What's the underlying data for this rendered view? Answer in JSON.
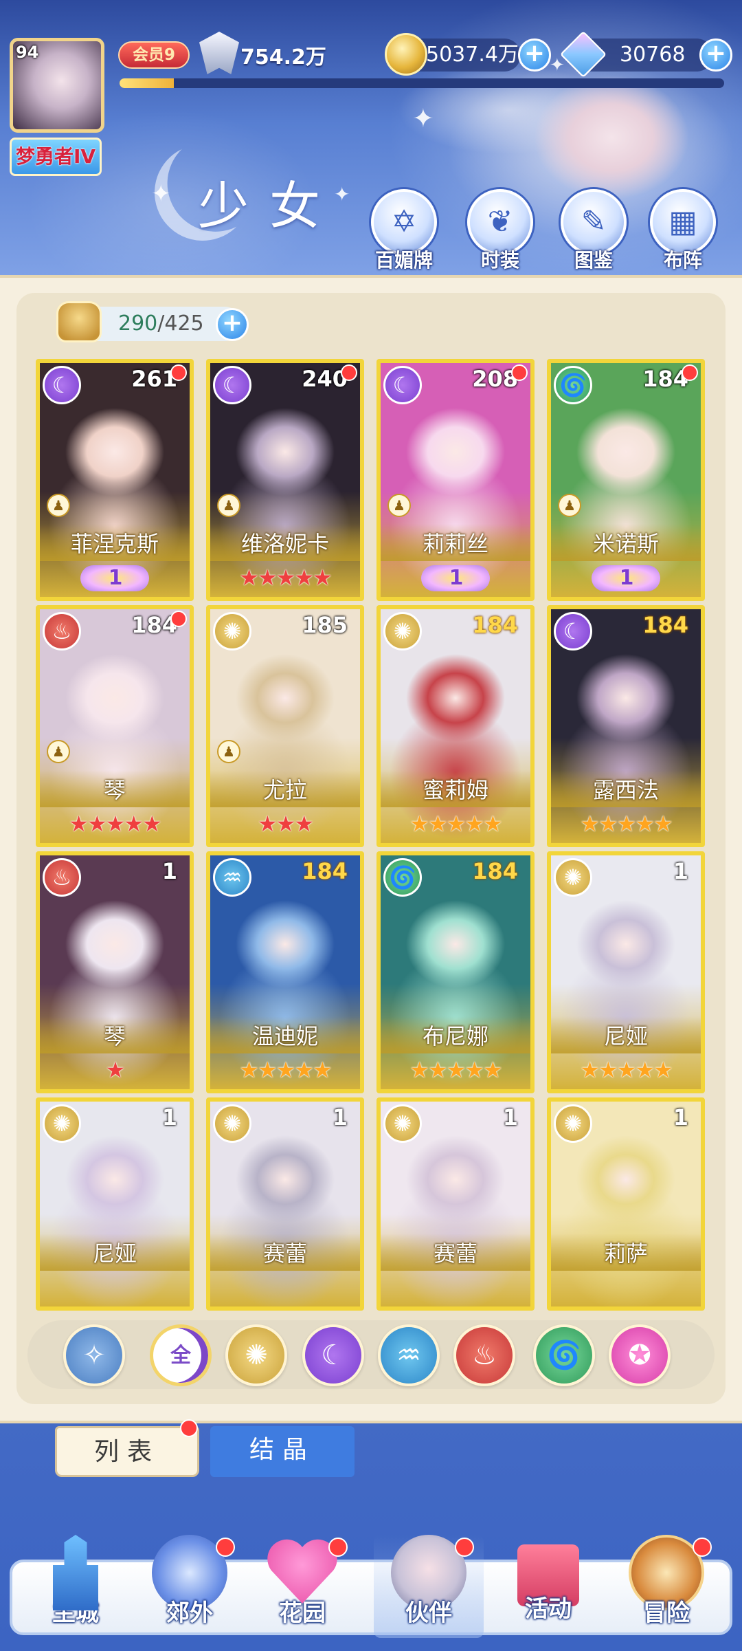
{
  "header": {
    "player_level": "94",
    "player_title": "梦勇者IV",
    "vip_label": "会员9",
    "power": "754.2万",
    "exp_progress": 0.09,
    "gold": "5037.4万",
    "gems": "30768",
    "page_title": "少女",
    "nav": [
      {
        "label": "百媚牌",
        "icon": "card-icon"
      },
      {
        "label": "时装",
        "icon": "outfit-icon"
      },
      {
        "label": "图鉴",
        "icon": "book-icon"
      },
      {
        "label": "布阵",
        "icon": "formation-icon"
      }
    ]
  },
  "collection": {
    "current": "290",
    "total": "425"
  },
  "cards": [
    {
      "name": "菲涅克斯",
      "level": "261",
      "element": "moon",
      "stars": "",
      "star_color": "",
      "wing": "1",
      "dot": true,
      "pawn": true,
      "level_gold": false
    },
    {
      "name": "维洛妮卡",
      "level": "240",
      "element": "moon",
      "stars": "★★★★★",
      "star_color": "red",
      "wing": "",
      "dot": true,
      "pawn": true,
      "level_gold": false
    },
    {
      "name": "莉莉丝",
      "level": "208",
      "element": "moon",
      "stars": "",
      "star_color": "",
      "wing": "1",
      "dot": true,
      "pawn": true,
      "level_gold": false
    },
    {
      "name": "米诺斯",
      "level": "184",
      "element": "wind",
      "stars": "",
      "star_color": "",
      "wing": "1",
      "dot": true,
      "pawn": true,
      "level_gold": false
    },
    {
      "name": "琴",
      "level": "184",
      "element": "fire",
      "stars": "★★★★★",
      "star_color": "red",
      "wing": "",
      "dot": true,
      "pawn": true,
      "level_gold": false
    },
    {
      "name": "尤拉",
      "level": "185",
      "element": "sun",
      "stars": "★★★",
      "star_color": "red",
      "wing": "",
      "dot": false,
      "pawn": true,
      "level_gold": false
    },
    {
      "name": "蜜莉姆",
      "level": "184",
      "element": "sun",
      "stars": "★★★★★",
      "star_color": "gold",
      "wing": "",
      "dot": false,
      "pawn": false,
      "level_gold": true
    },
    {
      "name": "露西法",
      "level": "184",
      "element": "moon",
      "stars": "★★★★★",
      "star_color": "gold",
      "wing": "",
      "dot": false,
      "pawn": false,
      "level_gold": true
    },
    {
      "name": "琴",
      "level": "1",
      "element": "fire",
      "stars": "★",
      "star_color": "red",
      "wing": "",
      "dot": false,
      "pawn": false,
      "level_gold": false
    },
    {
      "name": "温迪妮",
      "level": "184",
      "element": "water",
      "stars": "★★★★★",
      "star_color": "gold",
      "wing": "",
      "dot": false,
      "pawn": false,
      "level_gold": true
    },
    {
      "name": "布尼娜",
      "level": "184",
      "element": "wind",
      "stars": "★★★★★",
      "star_color": "gold",
      "wing": "",
      "dot": false,
      "pawn": false,
      "level_gold": true
    },
    {
      "name": "尼娅",
      "level": "1",
      "element": "sun",
      "stars": "★★★★★",
      "star_color": "gold",
      "wing": "",
      "dot": false,
      "pawn": false,
      "level_gold": false
    },
    {
      "name": "尼娅",
      "level": "1",
      "element": "sun",
      "stars": "",
      "star_color": "",
      "wing": "",
      "dot": false,
      "pawn": false,
      "level_gold": false
    },
    {
      "name": "赛蕾",
      "level": "1",
      "element": "sun",
      "stars": "",
      "star_color": "",
      "wing": "",
      "dot": false,
      "pawn": false,
      "level_gold": false
    },
    {
      "name": "赛蕾",
      "level": "1",
      "element": "sun",
      "stars": "",
      "star_color": "",
      "wing": "",
      "dot": false,
      "pawn": false,
      "level_gold": false
    },
    {
      "name": "莉萨",
      "level": "1",
      "element": "sun",
      "stars": "",
      "star_color": "",
      "wing": "",
      "dot": false,
      "pawn": false,
      "level_gold": false
    }
  ],
  "filters": [
    {
      "label": "",
      "icon": "rank-icon",
      "kind": "rank"
    },
    {
      "label": "全",
      "icon": "all-icon",
      "kind": "all"
    },
    {
      "label": "",
      "icon": "sun-icon",
      "kind": "sun"
    },
    {
      "label": "",
      "icon": "moon-icon",
      "kind": "moon"
    },
    {
      "label": "",
      "icon": "water-icon",
      "kind": "water"
    },
    {
      "label": "",
      "icon": "fire-icon",
      "kind": "fire"
    },
    {
      "label": "",
      "icon": "wind-icon",
      "kind": "wind"
    },
    {
      "label": "",
      "icon": "star-orb-icon",
      "kind": "pink"
    }
  ],
  "tabs": {
    "list": "列表",
    "crystal": "结晶"
  },
  "bottom_nav": [
    {
      "label": "主城",
      "icon": "castle-icon",
      "dot": false
    },
    {
      "label": "郊外",
      "icon": "portal-icon",
      "dot": true
    },
    {
      "label": "花园",
      "icon": "heart-icon",
      "dot": true
    },
    {
      "label": "伙伴",
      "icon": "girl-icon",
      "dot": true
    },
    {
      "label": "活动",
      "icon": "gift-icon",
      "dot": false
    },
    {
      "label": "冒险",
      "icon": "compass-icon",
      "dot": true
    }
  ],
  "colors": {
    "card_border": "#f2d53a",
    "accent_blue": "#3f7ce0",
    "notification_red": "#ff3d3d"
  }
}
